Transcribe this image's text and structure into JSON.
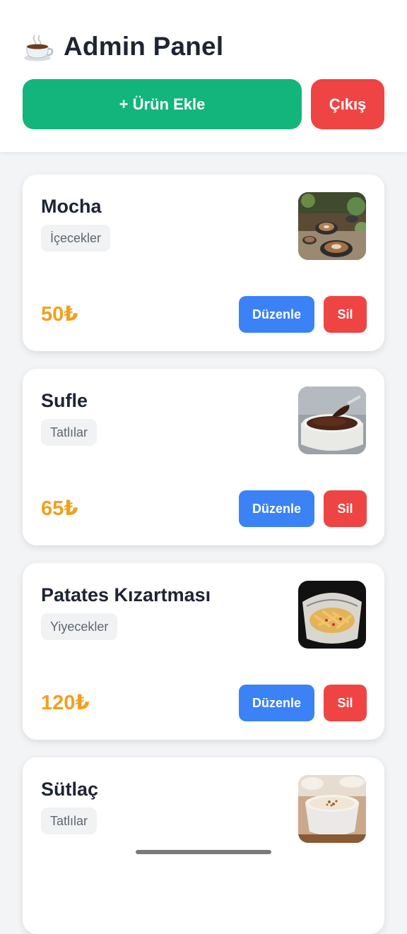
{
  "header": {
    "title": "Admin Panel",
    "icon": "coffee-cup-icon",
    "add_button_label": "+ Ürün Ekle",
    "logout_button_label": "Çıkış"
  },
  "colors": {
    "add_button": "#13b57c",
    "danger": "#ef4444",
    "edit_button": "#3b82f6",
    "price": "#f0a020",
    "background": "#f3f4f6"
  },
  "products": [
    {
      "name": "Mocha",
      "category": "İçecekler",
      "price": "50₺",
      "image": "coffee-cups-image",
      "edit_label": "Düzenle",
      "delete_label": "Sil"
    },
    {
      "name": "Sufle",
      "category": "Tatlılar",
      "price": "65₺",
      "image": "chocolate-souffle-image",
      "edit_label": "Düzenle",
      "delete_label": "Sil"
    },
    {
      "name": "Patates Kızartması",
      "category": "Yiyecekler",
      "price": "120₺",
      "image": "french-fries-image",
      "edit_label": "Düzenle",
      "delete_label": "Sil"
    },
    {
      "name": "Sütlaç",
      "category": "Tatlılar",
      "price": "",
      "image": "rice-pudding-image",
      "edit_label": "",
      "delete_label": ""
    }
  ]
}
